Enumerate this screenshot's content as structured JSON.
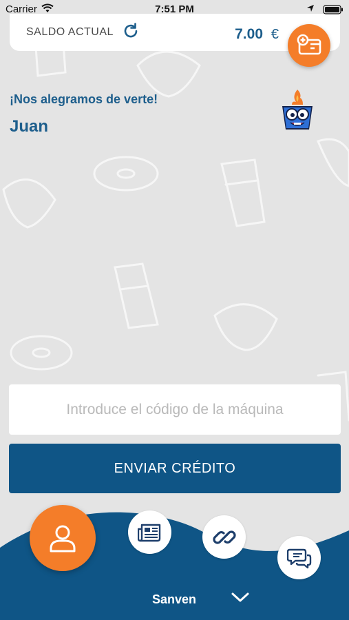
{
  "status_bar": {
    "carrier": "Carrier",
    "time": "7:51 PM"
  },
  "balance": {
    "label": "SALDO ACTUAL",
    "amount": "7.00",
    "currency": "€"
  },
  "greeting": {
    "welcome": "¡Nos alegramos de verte!",
    "name": "Juan"
  },
  "form": {
    "code_placeholder": "Introduce el código de la máquina",
    "code_value": "",
    "send_label": "ENVIAR CRÉDITO"
  },
  "bottom_nav": {
    "brand": "Sanven",
    "icons": [
      "user-icon",
      "newspaper-icon",
      "link-icon",
      "chat-icon",
      "chevron-down-icon"
    ]
  },
  "colors": {
    "accent_orange": "#f47d29",
    "primary_blue": "#0f5586",
    "text_blue": "#1d5e8c",
    "background": "#e4e4e4"
  }
}
